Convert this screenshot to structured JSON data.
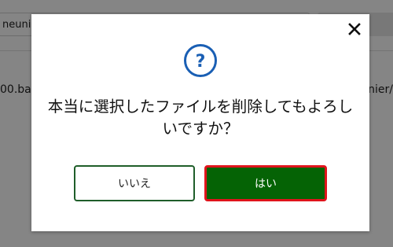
{
  "background": {
    "path_field_text": "neunie",
    "file_left_text": "00.bak",
    "file_right_text": "nier/"
  },
  "dialog": {
    "close_icon": "close-icon",
    "help_icon": "question-circle-icon",
    "help_symbol": "?",
    "message": "本当に選択したファイルを削除してもよろしいですか？",
    "no_label": "いいえ",
    "yes_label": "はい",
    "accent_color": "#1a5fb4",
    "yes_color": "#056305",
    "focus_ring_color": "#e0141c"
  }
}
